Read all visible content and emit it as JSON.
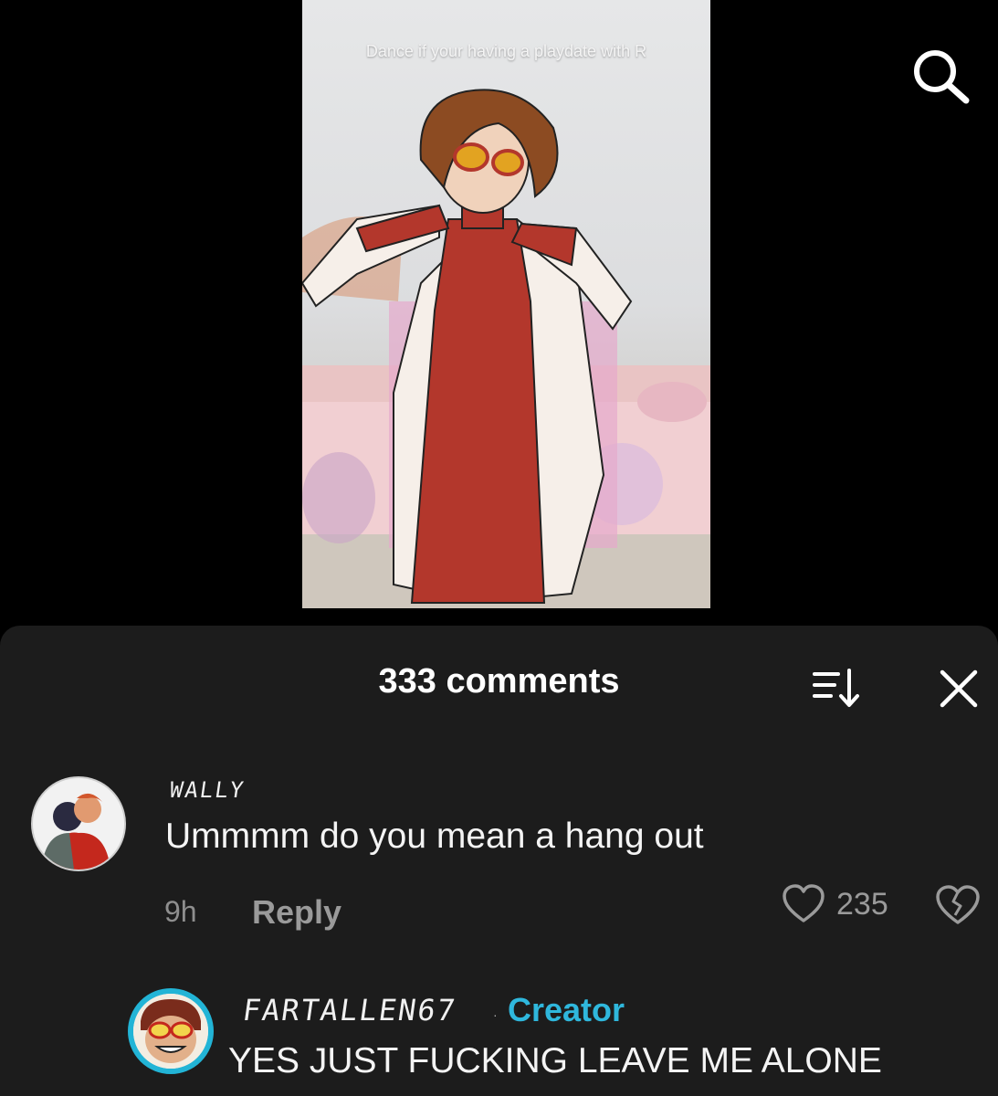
{
  "video": {
    "caption": "Dance if your having a playdate with R"
  },
  "header": {
    "search_icon": "search-icon"
  },
  "comments": {
    "count_label": "333 comments",
    "sort_icon": "sort-icon",
    "close_icon": "close-icon",
    "items": [
      {
        "username": "WALLY",
        "text": "Ummmm do you mean a hang out",
        "time": "9h",
        "reply_label": "Reply",
        "likes": "235"
      },
      {
        "username": "FARTALLEN67",
        "badge": "Creator",
        "text": "YES JUST FUCKING LEAVE ME ALONE"
      }
    ]
  },
  "colors": {
    "sheet_bg": "#1c1c1c",
    "creator_accent": "#2fb7dc",
    "muted_text": "#9a9a9a"
  }
}
